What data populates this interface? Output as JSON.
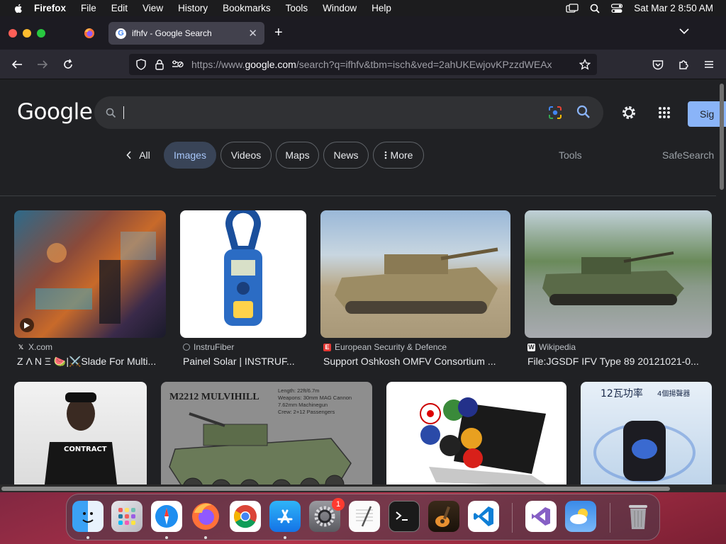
{
  "menubar": {
    "app_name": "Firefox",
    "items": [
      "File",
      "Edit",
      "View",
      "History",
      "Bookmarks",
      "Tools",
      "Window",
      "Help"
    ],
    "clock": "Sat Mar 2  8:50 AM"
  },
  "browser": {
    "tab_title": "ifhfv - Google Search",
    "url_prefix": "https://www.",
    "url_domain": "google.com",
    "url_rest": "/search?q=ifhfv&tbm=isch&ved=2ahUKEwjovKPzzdWEAx"
  },
  "google": {
    "logo": "Google",
    "search_value": "",
    "sign_in": "Sig",
    "filters": {
      "back": "All",
      "images": "Images",
      "videos": "Videos",
      "maps": "Maps",
      "news": "News",
      "more": "More",
      "tools": "Tools",
      "safesearch": "SafeSearch"
    },
    "results": [
      {
        "source": "X.com",
        "title": "Z Λ N Ξ 🍉|⚔️Slade For Multi..."
      },
      {
        "source": "InstruFiber",
        "title": "Painel Solar | INSTRUF..."
      },
      {
        "source": "European Security & Defence",
        "title": "Support Oshkosh OMFV Consortium ..."
      },
      {
        "source": "Wikipedia",
        "title": "File:JGSDF IFV Type 89 20121021-0..."
      }
    ],
    "image_texts": {
      "contract_shirt": "CONTRACT",
      "m2212_title": "M2212 MULVIHILL",
      "m2212_specs": [
        "Length: 22ft/6.7m",
        "Weapons: 30mm MAG Cannon",
        "7.62mm Machinegun",
        "Crew: 2+12 Passengers"
      ],
      "speaker_title": "12瓦功率",
      "speaker_sub": "4個揚聲器"
    }
  },
  "dock": {
    "apps": [
      "finder-icon",
      "launchpad-icon",
      "safari-icon",
      "firefox-icon",
      "chrome-icon",
      "app-store-icon",
      "system-settings-icon",
      "textedit-icon",
      "terminal-icon",
      "garageband-icon",
      "vscode-icon",
      "visual-studio-icon",
      "weather-icon",
      "trash-icon"
    ],
    "settings_badge": "1"
  }
}
